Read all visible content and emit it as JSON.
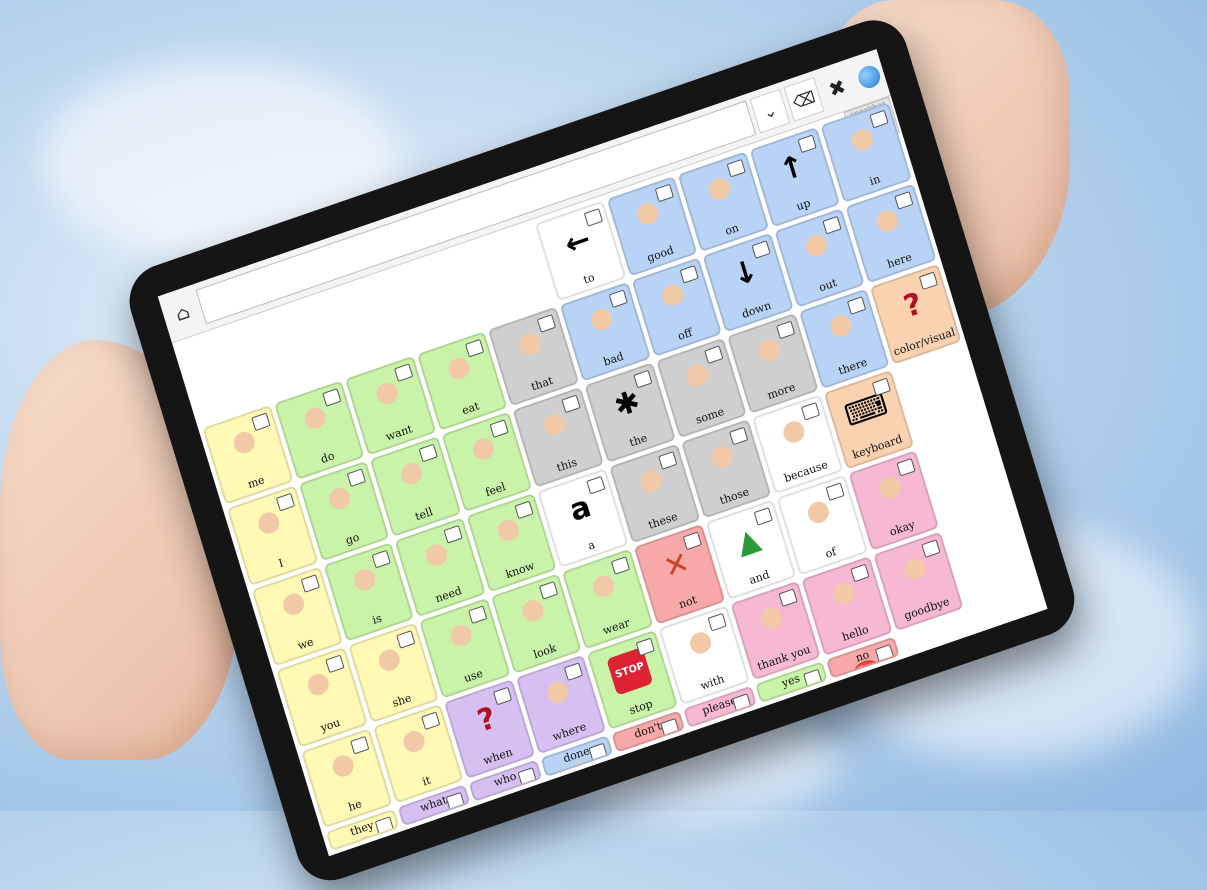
{
  "colors": {
    "yellow": "#fff9b5",
    "green": "#c9f3a8",
    "blue": "#b8d3f5",
    "gray": "#cfcfcf",
    "white": "#ffffff",
    "pink": "#f7b8d4",
    "red": "#f7a8a8",
    "purple": "#d6c0f2",
    "orange": "#fbd2b0"
  },
  "toolbar": {
    "home_icon": "home-icon",
    "dropdown_icon": "chevron-down-icon",
    "clear_icon": "backspace-icon",
    "close_icon": "close-icon",
    "app_icon": "globe-icon",
    "speakbar_label": "speakbar"
  },
  "cells": [
    {
      "label": "",
      "color": "none"
    },
    {
      "label": "",
      "color": "none"
    },
    {
      "label": "",
      "color": "none"
    },
    {
      "label": "",
      "color": "none"
    },
    {
      "label": "",
      "color": "none"
    },
    {
      "label": "to",
      "color": "white",
      "icon": "arrow-left-icon",
      "glyph": "←"
    },
    {
      "label": "good",
      "color": "blue",
      "icon": "face-icon"
    },
    {
      "label": "on",
      "color": "blue",
      "icon": "on-icon"
    },
    {
      "label": "up",
      "color": "blue",
      "icon": "arrow-up-icon",
      "glyph": "↑"
    },
    {
      "label": "in",
      "color": "blue",
      "icon": "in-icon"
    },
    {
      "label": "me",
      "color": "yellow",
      "icon": "person-icon"
    },
    {
      "label": "do",
      "color": "green",
      "icon": "person-icon"
    },
    {
      "label": "want",
      "color": "green",
      "icon": "hand-icon"
    },
    {
      "label": "eat",
      "color": "green",
      "icon": "face-icon"
    },
    {
      "label": "that",
      "color": "gray",
      "icon": "point-icon"
    },
    {
      "label": "bad",
      "color": "blue",
      "icon": "face-icon"
    },
    {
      "label": "off",
      "color": "blue",
      "icon": "off-icon"
    },
    {
      "label": "down",
      "color": "blue",
      "icon": "arrow-down-icon",
      "glyph": "↓"
    },
    {
      "label": "out",
      "color": "blue",
      "icon": "out-icon"
    },
    {
      "label": "here",
      "color": "blue",
      "icon": "here-icon"
    },
    {
      "label": "I",
      "color": "yellow",
      "icon": "person-icon"
    },
    {
      "label": "go",
      "color": "green",
      "icon": "person-icon"
    },
    {
      "label": "tell",
      "color": "green",
      "icon": "face-icon"
    },
    {
      "label": "feel",
      "color": "green",
      "icon": "face-icon"
    },
    {
      "label": "this",
      "color": "gray",
      "icon": "point-icon"
    },
    {
      "label": "the",
      "color": "gray",
      "icon": "asterisk-icon",
      "glyph": "✱"
    },
    {
      "label": "some",
      "color": "gray",
      "icon": "dots-icon"
    },
    {
      "label": "more",
      "color": "gray",
      "icon": "dots-icon"
    },
    {
      "label": "there",
      "color": "blue",
      "icon": "there-icon"
    },
    {
      "label": "color/visual",
      "color": "orange",
      "icon": "question-icon",
      "glyph": "?"
    },
    {
      "label": "we",
      "color": "yellow",
      "icon": "people-icon"
    },
    {
      "label": "is",
      "color": "green",
      "icon": "hand-icon"
    },
    {
      "label": "need",
      "color": "green",
      "icon": "face-icon"
    },
    {
      "label": "know",
      "color": "green",
      "icon": "person-icon"
    },
    {
      "label": "a",
      "color": "white",
      "icon": "letter-a-icon",
      "glyph": "a"
    },
    {
      "label": "these",
      "color": "gray",
      "icon": "dots-icon"
    },
    {
      "label": "those",
      "color": "gray",
      "icon": "dots-icon"
    },
    {
      "label": "because",
      "color": "white",
      "icon": "arrow-icon"
    },
    {
      "label": "keyboard",
      "color": "orange",
      "icon": "keyboard-icon",
      "glyph": "⌨"
    },
    {
      "label": "",
      "color": "none"
    },
    {
      "label": "you",
      "color": "yellow",
      "icon": "person-icon"
    },
    {
      "label": "she",
      "color": "yellow",
      "icon": "person-icon"
    },
    {
      "label": "use",
      "color": "green",
      "icon": "hand-icon"
    },
    {
      "label": "look",
      "color": "green",
      "icon": "face-icon"
    },
    {
      "label": "wear",
      "color": "green",
      "icon": "shirt-icon"
    },
    {
      "label": "not",
      "color": "red",
      "icon": "cross-icon",
      "glyph": "✕"
    },
    {
      "label": "and",
      "color": "white",
      "icon": "triangle-icon",
      "glyph": "▲"
    },
    {
      "label": "of",
      "color": "white",
      "icon": "arrow-icon"
    },
    {
      "label": "okay",
      "color": "pink",
      "icon": "thumbs-up-icon"
    },
    {
      "label": "",
      "color": "none"
    },
    {
      "label": "he",
      "color": "yellow",
      "icon": "person-icon"
    },
    {
      "label": "it",
      "color": "yellow",
      "icon": "point-icon"
    },
    {
      "label": "when",
      "color": "purple",
      "icon": "question-icon",
      "glyph": "?"
    },
    {
      "label": "where",
      "color": "purple",
      "icon": "arrows-icon"
    },
    {
      "label": "stop",
      "color": "green",
      "icon": "stop-sign-icon",
      "glyph": "STOP"
    },
    {
      "label": "with",
      "color": "white",
      "icon": "squares-icon"
    },
    {
      "label": "thank you",
      "color": "pink",
      "icon": "people-icon"
    },
    {
      "label": "hello",
      "color": "pink",
      "icon": "person-icon"
    },
    {
      "label": "goodbye",
      "color": "pink",
      "icon": "person-icon"
    },
    {
      "label": "",
      "color": "none"
    }
  ],
  "bottom_rows": [
    {
      "label": "they",
      "color": "yellow",
      "icon": "people-icon"
    },
    {
      "label": "what",
      "color": "purple",
      "icon": "question-icon",
      "glyph": "?"
    },
    {
      "label": "who",
      "color": "purple",
      "icon": "question-icon",
      "glyph": "?"
    },
    {
      "label": "done",
      "color": "blue",
      "icon": "person-icon"
    },
    {
      "label": "don't",
      "color": "red",
      "icon": "cross-icon",
      "glyph": "✕"
    },
    {
      "label": "please",
      "color": "pink",
      "icon": "person-icon"
    },
    {
      "label": "yes",
      "color": "green",
      "icon": "check-icon",
      "glyph": "✓"
    },
    {
      "label": "no",
      "color": "red",
      "icon": "no-entry-icon",
      "glyph": "⛔"
    }
  ]
}
